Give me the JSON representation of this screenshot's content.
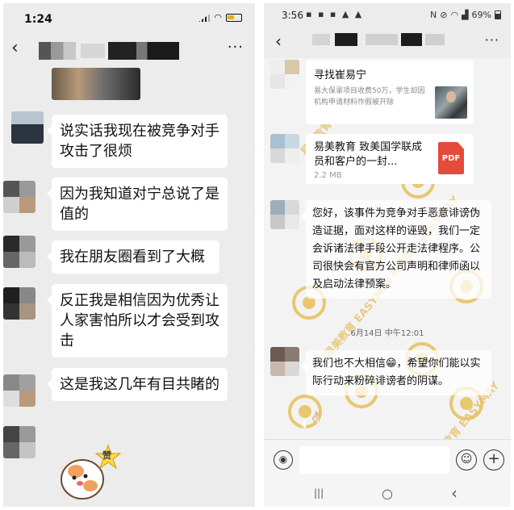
{
  "left": {
    "status": {
      "time": "1:24"
    },
    "nav": {
      "more": "···",
      "back": "‹"
    },
    "messages": [
      {
        "text": "说实话我现在被竞争对手攻击了很烦"
      },
      {
        "text": "因为我知道对宁总说了是值的"
      },
      {
        "text": "我在朋友圈看到了大概"
      },
      {
        "text": "反正我是相信因为优秀让人家害怕所以才会受到攻击"
      },
      {
        "text": "这是我这几年有目共睹的"
      }
    ],
    "sticker": {
      "label": "赞"
    }
  },
  "right": {
    "status": {
      "time": "3:56",
      "notif_icons": "▪ ▪ ▪ ▲ ▲",
      "battery": "69%"
    },
    "nav": {
      "back": "‹",
      "more": "···"
    },
    "link_card": {
      "title": "寻找崔易宁",
      "desc": "易大保录项目收费50万，学生却因机构申请材料作假被开除"
    },
    "file_card": {
      "name": "易美教育    致美国学联成员和客户的一封...",
      "size": "2.2 MB",
      "icon_label": "PDF"
    },
    "message_1": "您好，该事件为竞争对手恶意诽谤伪造证据，面对这样的诬毁，我们一定会诉诸法律手段公开走法律程序。公司很快会有官方公司声明和律师函以及启动法律预案。",
    "timestamp": "6月14日 中午12:01",
    "message_2": "我们也不大相信😁，希望你们能以实际行动来粉碎诽谤者的阴谋。",
    "message_3": "👌🏻",
    "watermark_text": "易美教育 EASYMAY",
    "toolbar": {
      "voice": "◉",
      "emoji": "☺",
      "plus": "+"
    },
    "sysnav": {
      "recent": "|||",
      "home": "○",
      "back": "‹"
    }
  }
}
